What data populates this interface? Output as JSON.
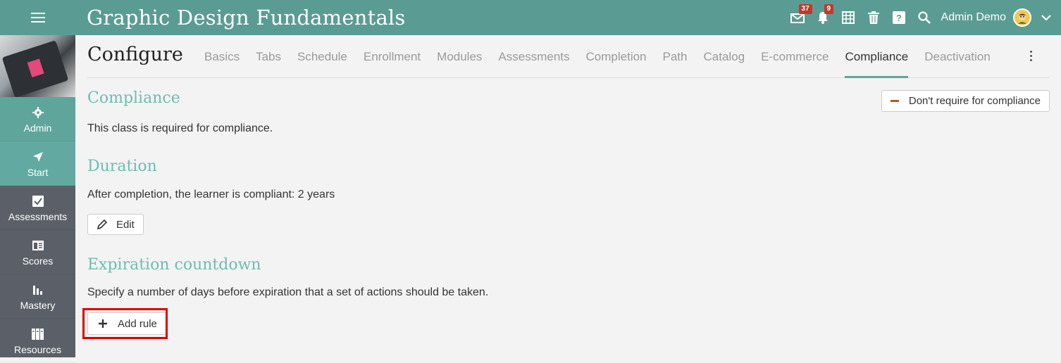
{
  "header": {
    "title": "Graphic Design Fundamentals",
    "inbox_badge": "37",
    "notif_badge": "9",
    "user_name": "Admin Demo"
  },
  "sidebar": {
    "items": [
      {
        "label": "Admin",
        "icon": "gear-icon"
      },
      {
        "label": "Start",
        "icon": "navigation-arrow-icon"
      },
      {
        "label": "Assessments",
        "icon": "checkbox-icon"
      },
      {
        "label": "Scores",
        "icon": "gradebook-icon"
      },
      {
        "label": "Mastery",
        "icon": "bar-chart-icon"
      },
      {
        "label": "Resources",
        "icon": "books-icon"
      }
    ]
  },
  "main": {
    "page_title": "Configure",
    "tabs": [
      "Basics",
      "Tabs",
      "Schedule",
      "Enrollment",
      "Modules",
      "Assessments",
      "Completion",
      "Path",
      "Catalog",
      "E-commerce",
      "Compliance",
      "Deactivation"
    ],
    "active_tab": "Compliance",
    "compliance": {
      "heading": "Compliance",
      "text": "This class is required for compliance.",
      "toggle_label": "Don't require for compliance"
    },
    "duration": {
      "heading": "Duration",
      "text": "After completion, the learner is compliant: 2 years",
      "edit_label": "Edit"
    },
    "expiration": {
      "heading": "Expiration countdown",
      "text": "Specify a number of days before expiration that a set of actions should be taken.",
      "add_rule_label": "Add rule"
    }
  },
  "colors": {
    "topbar": "#5a9c93",
    "accent": "#6cbdb4",
    "sidebar": "#5b6068",
    "highlight": "#e00000"
  }
}
